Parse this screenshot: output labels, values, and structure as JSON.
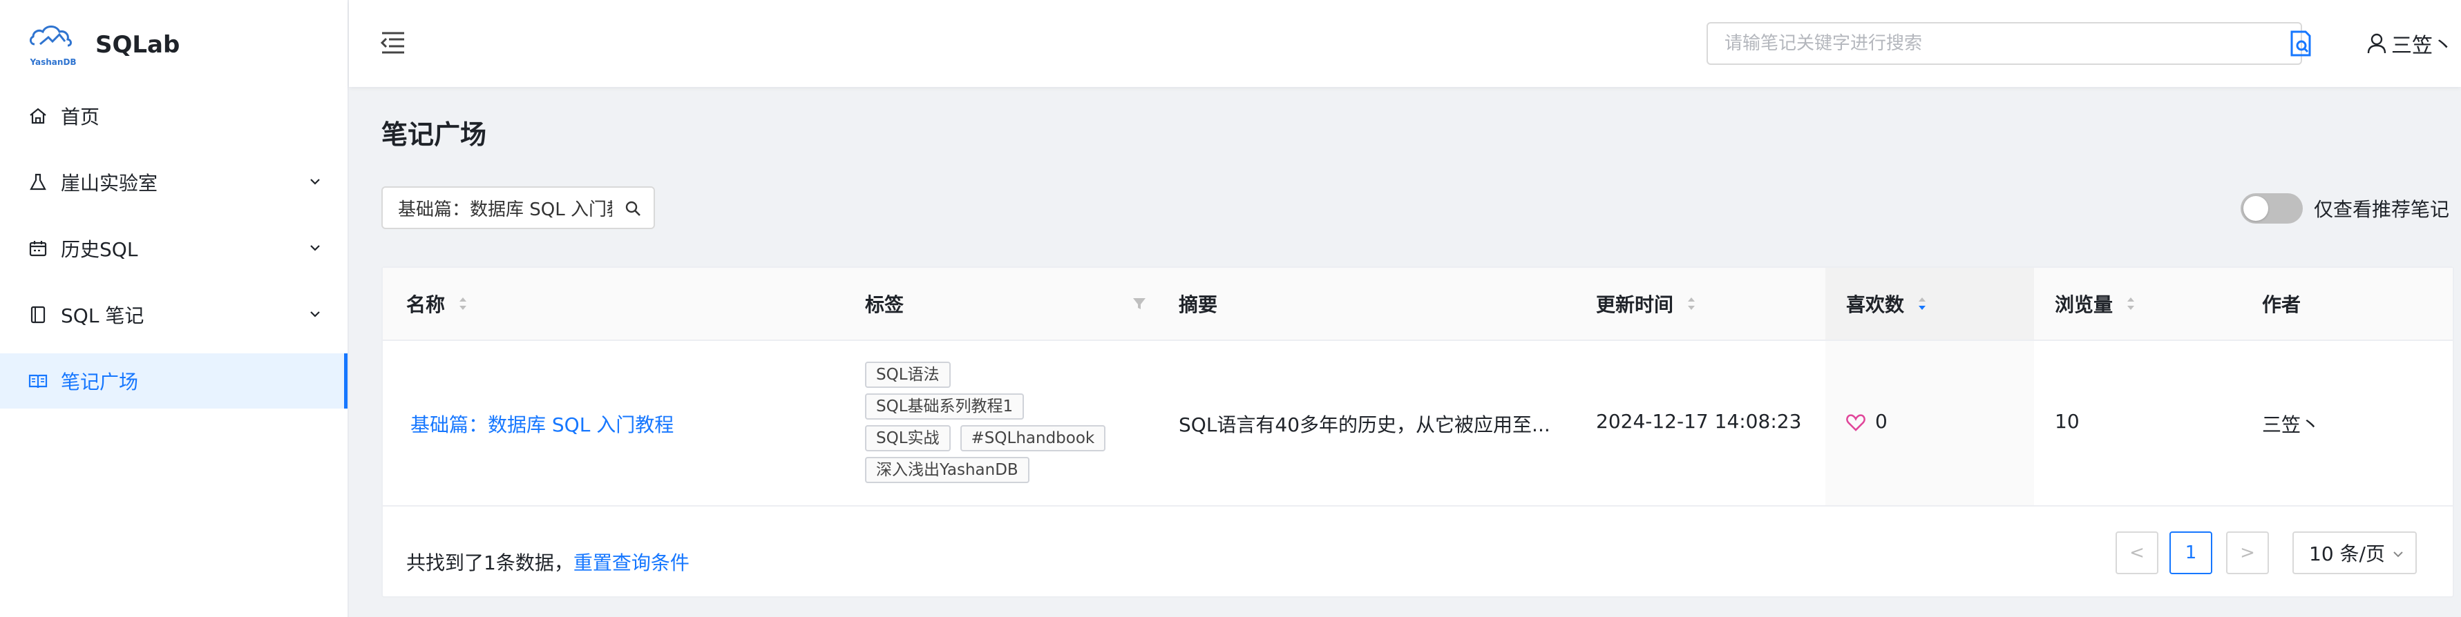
{
  "brand": {
    "name": "SQLab",
    "logo_text": "YashanDB",
    "logo_color": "#2f74d0"
  },
  "sidebar": {
    "items": [
      {
        "label": "首页",
        "icon": "home-icon",
        "expandable": false,
        "active": false
      },
      {
        "label": "崖山实验室",
        "icon": "flask-icon",
        "expandable": true,
        "active": false
      },
      {
        "label": "历史SQL",
        "icon": "calendar-icon",
        "expandable": true,
        "active": false
      },
      {
        "label": "SQL 笔记",
        "icon": "notebook-icon",
        "expandable": true,
        "active": false
      },
      {
        "label": "笔记广场",
        "icon": "book-open-icon",
        "expandable": false,
        "active": true
      }
    ]
  },
  "header": {
    "search_placeholder": "请输笔记关键字进行搜索",
    "user_name": "三笠丶",
    "icons": [
      "menu-collapse-icon",
      "note-search-icon",
      "user-icon"
    ]
  },
  "page": {
    "title": "笔记广场"
  },
  "filter": {
    "value": "基础篇：数据库 SQL 入门教程"
  },
  "toggle": {
    "label": "仅查看推荐笔记",
    "on": false
  },
  "table": {
    "columns": [
      "名称",
      "标签",
      "摘要",
      "更新时间",
      "喜欢数",
      "浏览量",
      "作者"
    ],
    "sorted_column": "喜欢数",
    "rows": [
      {
        "name": "基础篇：数据库 SQL 入门教程",
        "tags": [
          "SQL语法",
          "SQL基础系列教程1",
          "SQL实战",
          "#SQLhandbook",
          "深入浅出YashanDB"
        ],
        "summary": "SQL语言有40多年的历史，从它被应用至...",
        "updated": "2024-12-17 14:08:23",
        "likes": "0",
        "views": "10",
        "author": "三笠丶"
      }
    ]
  },
  "footer": {
    "summary_text": "共找到了1条数据，",
    "reset_link": "重置查询条件",
    "prev": "<",
    "current_page": "1",
    "next": ">",
    "page_size": "10 条/页"
  },
  "colors": {
    "accent": "#1677ff",
    "heart": "#e0469a",
    "toggle_off": "#bfbfbf"
  }
}
